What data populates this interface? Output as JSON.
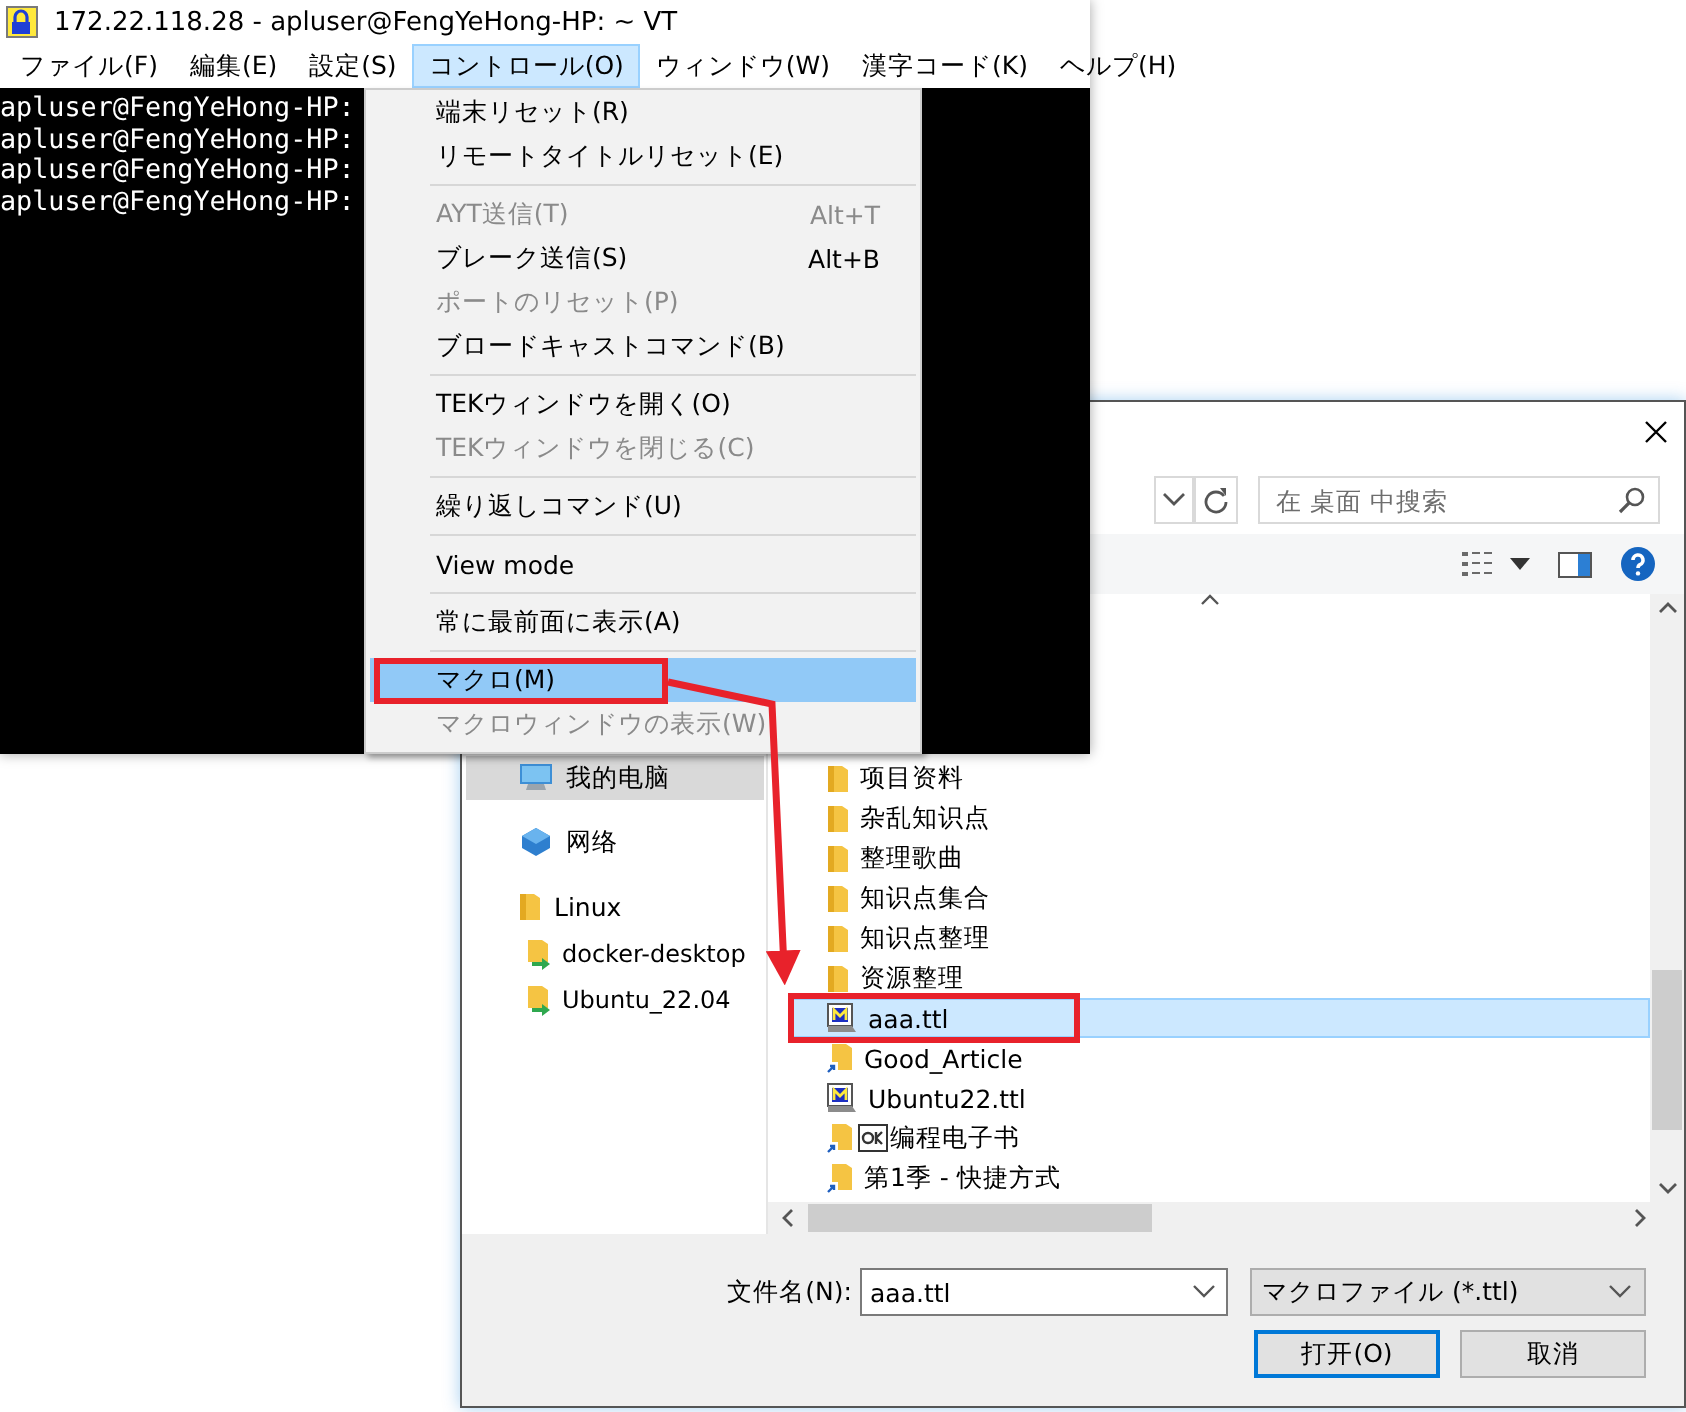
{
  "terminal": {
    "title": "172.22.118.28 - apluser@FengYeHong-HP: ~ VT",
    "menubar": [
      {
        "label": "ファイル(F)",
        "selected": false
      },
      {
        "label": "編集(E)",
        "selected": false
      },
      {
        "label": "設定(S)",
        "selected": false
      },
      {
        "label": "コントロール(O)",
        "selected": true
      },
      {
        "label": "ウィンドウ(W)",
        "selected": false
      },
      {
        "label": "漢字コード(K)",
        "selected": false
      },
      {
        "label": "ヘルプ(H)",
        "selected": false
      }
    ],
    "lines": [
      "apluser@FengYeHong-HP:",
      "apluser@FengYeHong-HP:",
      "apluser@FengYeHong-HP:",
      "apluser@FengYeHong-HP:"
    ]
  },
  "dropdown": [
    {
      "kind": "item",
      "label": "端末リセット(R)",
      "disabled": false,
      "selected": false
    },
    {
      "kind": "item",
      "label": "リモートタイトルリセット(E)",
      "disabled": false,
      "selected": false
    },
    {
      "kind": "separator"
    },
    {
      "kind": "item",
      "label": "AYT送信(T)",
      "shortcut": "Alt+T",
      "disabled": true,
      "selected": false
    },
    {
      "kind": "item",
      "label": "ブレーク送信(S)",
      "shortcut": "Alt+B",
      "disabled": false,
      "selected": false
    },
    {
      "kind": "item",
      "label": "ポートのリセット(P)",
      "disabled": true,
      "selected": false
    },
    {
      "kind": "item",
      "label": "ブロードキャストコマンド(B)",
      "disabled": false,
      "selected": false
    },
    {
      "kind": "separator"
    },
    {
      "kind": "item",
      "label": "TEKウィンドウを開く(O)",
      "disabled": false,
      "selected": false
    },
    {
      "kind": "item",
      "label": "TEKウィンドウを閉じる(C)",
      "disabled": true,
      "selected": false
    },
    {
      "kind": "separator"
    },
    {
      "kind": "item",
      "label": "繰り返しコマンド(U)",
      "disabled": false,
      "selected": false
    },
    {
      "kind": "separator"
    },
    {
      "kind": "item",
      "label": "View mode",
      "disabled": false,
      "selected": false
    },
    {
      "kind": "separator"
    },
    {
      "kind": "item",
      "label": "常に最前面に表示(A)",
      "disabled": false,
      "selected": false
    },
    {
      "kind": "separator"
    },
    {
      "kind": "item",
      "label": "マクロ(M)",
      "disabled": false,
      "selected": true
    },
    {
      "kind": "item",
      "label": "マクロウィンドウの表示(W)",
      "disabled": true,
      "selected": false
    }
  ],
  "dialog": {
    "search": {
      "placeholder": "在 桌面 中搜索"
    },
    "nav": [
      {
        "label": "我的电脑",
        "kind": "computer",
        "selected": true
      },
      {
        "label": "网络",
        "kind": "network",
        "selected": false
      },
      {
        "label": "Linux",
        "kind": "folder",
        "selected": false,
        "children": [
          {
            "label": "docker-desktop",
            "kind": "share",
            "selected": false
          },
          {
            "label": "Ubuntu_22.04",
            "kind": "share",
            "selected": false
          }
        ]
      }
    ],
    "files": [
      {
        "name": "项目资料",
        "kind": "folder",
        "selected": false
      },
      {
        "name": "杂乱知识点",
        "kind": "folder",
        "selected": false
      },
      {
        "name": "整理歌曲",
        "kind": "folder",
        "selected": false
      },
      {
        "name": "知识点集合",
        "kind": "folder",
        "selected": false
      },
      {
        "name": "知识点整理",
        "kind": "folder",
        "selected": false
      },
      {
        "name": "资源整理",
        "kind": "folder",
        "selected": false
      },
      {
        "name": "aaa.ttl",
        "kind": "macro",
        "selected": true
      },
      {
        "name": "Good_Article",
        "kind": "shortcut",
        "selected": false
      },
      {
        "name": "Ubuntu22.ttl",
        "kind": "macro",
        "selected": false
      },
      {
        "name": "编程电子书",
        "kind": "app-shortcut",
        "selected": false
      },
      {
        "name": "第1季 - 快捷方式",
        "kind": "shortcut",
        "selected": false
      }
    ],
    "filename": {
      "label": "文件名(N):",
      "value": "aaa.ttl"
    },
    "filetype": "マクロファイル (*.ttl)",
    "buttons": [
      {
        "label": "打开(O)",
        "default": true
      },
      {
        "label": "取消",
        "default": false
      }
    ]
  }
}
